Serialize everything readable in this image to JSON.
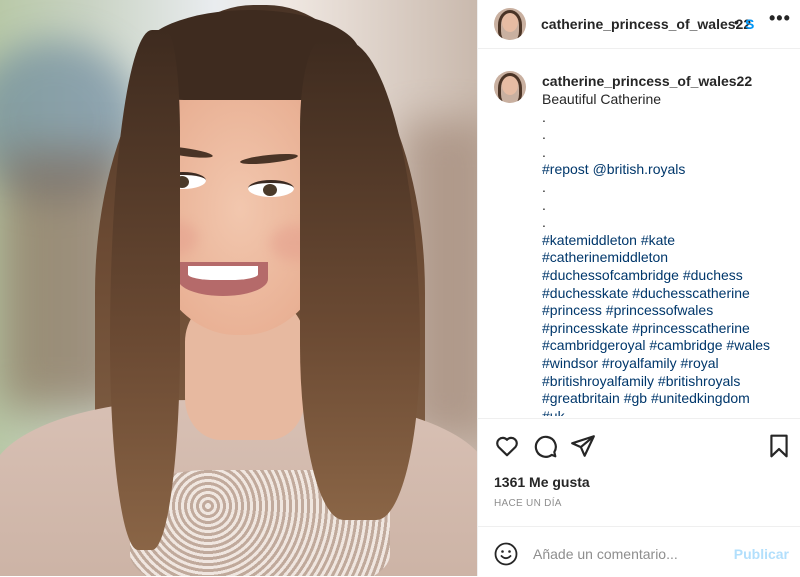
{
  "post": {
    "username": "catherine_princess_of_wales22",
    "header_dot": "•",
    "follow_label": "Seguir",
    "more_label": "•••"
  },
  "caption": {
    "username": "catherine_princess_of_wales22",
    "lines": [
      "Beautiful Catherine",
      ".",
      ".",
      ".",
      "#repost @british.royals",
      ".",
      ".",
      ".",
      "#katemiddleton #kate",
      "#catherinemiddleton",
      "#duchessofcambridge #duchess",
      "#duchesskate #duchesscatherine",
      "#princess #princessofwales",
      "#princesskate #princesscatherine",
      "#cambridgeroyal #cambridge #wales",
      "#windsor #royalfamily #royal",
      "#britishroyalfamily #britishroyals",
      "#greatbritain #gb #unitedkingdom",
      "#uk"
    ]
  },
  "stats": {
    "likes": "1361 Me gusta",
    "time": "HACE UN DÍA"
  },
  "comment": {
    "placeholder": "Añade un comentario...",
    "publish_label": "Publicar"
  },
  "colors": {
    "link": "#00376b",
    "follow": "#0095f6",
    "publish_disabled": "#b2dffc"
  }
}
